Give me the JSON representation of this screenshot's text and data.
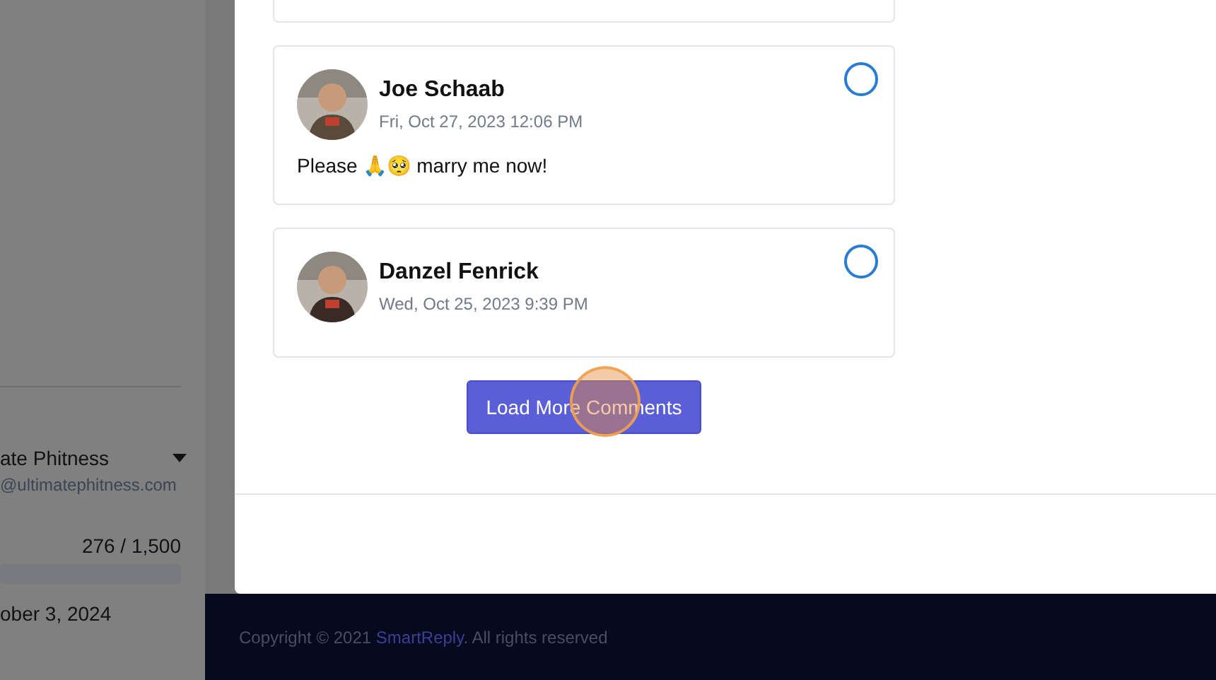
{
  "sidebar": {
    "account_name": "ate Phitness",
    "account_email": "@ultimatephitness.com",
    "usage": "276 / 1,500",
    "renewal_date": "ober 3, 2024"
  },
  "comments": [
    {
      "kind": "partial"
    },
    {
      "kind": "full",
      "name": "Joe Schaab",
      "date": "Fri, Oct 27, 2023 12:06 PM",
      "text": "Please 🙏🥺 marry me now!",
      "selected": false
    },
    {
      "kind": "full",
      "name": "Danzel Fenrick",
      "date": "Wed, Oct 25, 2023 9:39 PM",
      "selected": false
    }
  ],
  "load_more_button": "Load More Comments",
  "footer": {
    "prefix": "Copyright © 2021 ",
    "brand": "SmartReply",
    "suffix": ". All rights reserved"
  }
}
